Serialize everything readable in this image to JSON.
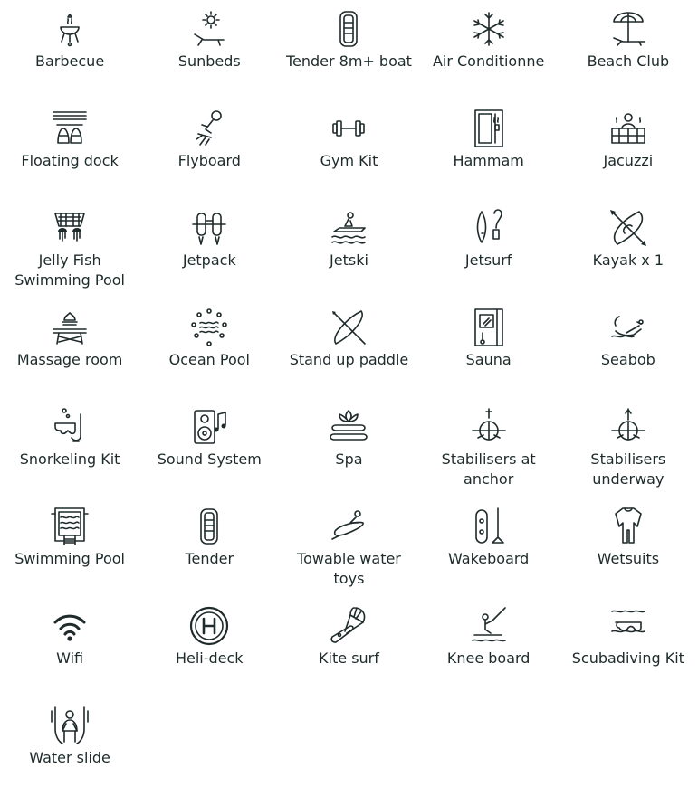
{
  "amenities": [
    {
      "label": "Barbecue",
      "icon": "barbecue-icon"
    },
    {
      "label": "Sunbeds",
      "icon": "sunbed-icon"
    },
    {
      "label": "Tender 8m+ boat",
      "icon": "tender-boat-icon"
    },
    {
      "label": "Air Conditionne",
      "icon": "snowflake-icon"
    },
    {
      "label": "Beach Club",
      "icon": "beach-umbrella-icon"
    },
    {
      "label": "Floating dock",
      "icon": "floating-dock-icon"
    },
    {
      "label": "Flyboard",
      "icon": "flyboard-icon"
    },
    {
      "label": "Gym Kit",
      "icon": "dumbbell-icon"
    },
    {
      "label": "Hammam",
      "icon": "hammam-icon"
    },
    {
      "label": "Jacuzzi",
      "icon": "jacuzzi-icon"
    },
    {
      "label": "Jelly Fish\nSwimming Pool",
      "icon": "jellyfish-pool-icon"
    },
    {
      "label": "Jetpack",
      "icon": "jetpack-icon"
    },
    {
      "label": "Jetski",
      "icon": "jetski-icon"
    },
    {
      "label": "Jetsurf",
      "icon": "jetsurf-icon"
    },
    {
      "label": "Kayak x 1",
      "icon": "kayak-icon"
    },
    {
      "label": "Massage room",
      "icon": "massage-table-icon"
    },
    {
      "label": "Ocean Pool",
      "icon": "ocean-pool-icon"
    },
    {
      "label": "Stand up paddle",
      "icon": "paddle-board-icon"
    },
    {
      "label": "Sauna",
      "icon": "sauna-icon"
    },
    {
      "label": "Seabob",
      "icon": "seabob-icon"
    },
    {
      "label": "Snorkeling Kit",
      "icon": "snorkel-icon"
    },
    {
      "label": "Sound System",
      "icon": "speaker-icon"
    },
    {
      "label": "Spa",
      "icon": "spa-stones-icon"
    },
    {
      "label": "Stabilisers at\nanchor",
      "icon": "stabiliser-anchor-icon"
    },
    {
      "label": "Stabilisers\nunderway",
      "icon": "stabiliser-underway-icon"
    },
    {
      "label": "Swimming Pool",
      "icon": "swimming-pool-icon"
    },
    {
      "label": "Tender",
      "icon": "tender-icon"
    },
    {
      "label": "Towable water\ntoys",
      "icon": "towable-toy-icon"
    },
    {
      "label": "Wakeboard",
      "icon": "wakeboard-icon"
    },
    {
      "label": "Wetsuits",
      "icon": "wetsuit-icon"
    },
    {
      "label": "Wifi",
      "icon": "wifi-icon"
    },
    {
      "label": "Heli-deck",
      "icon": "helipad-icon"
    },
    {
      "label": "Kite surf",
      "icon": "kitesurf-icon"
    },
    {
      "label": "Knee board",
      "icon": "kneeboard-icon"
    },
    {
      "label": "Scubadiving Kit",
      "icon": "scuba-mask-icon"
    },
    {
      "label": "Water slide",
      "icon": "water-slide-icon"
    }
  ],
  "colors": {
    "icon": "#1f2a2b",
    "text": "#1e2b2b",
    "background": "#ffffff"
  }
}
